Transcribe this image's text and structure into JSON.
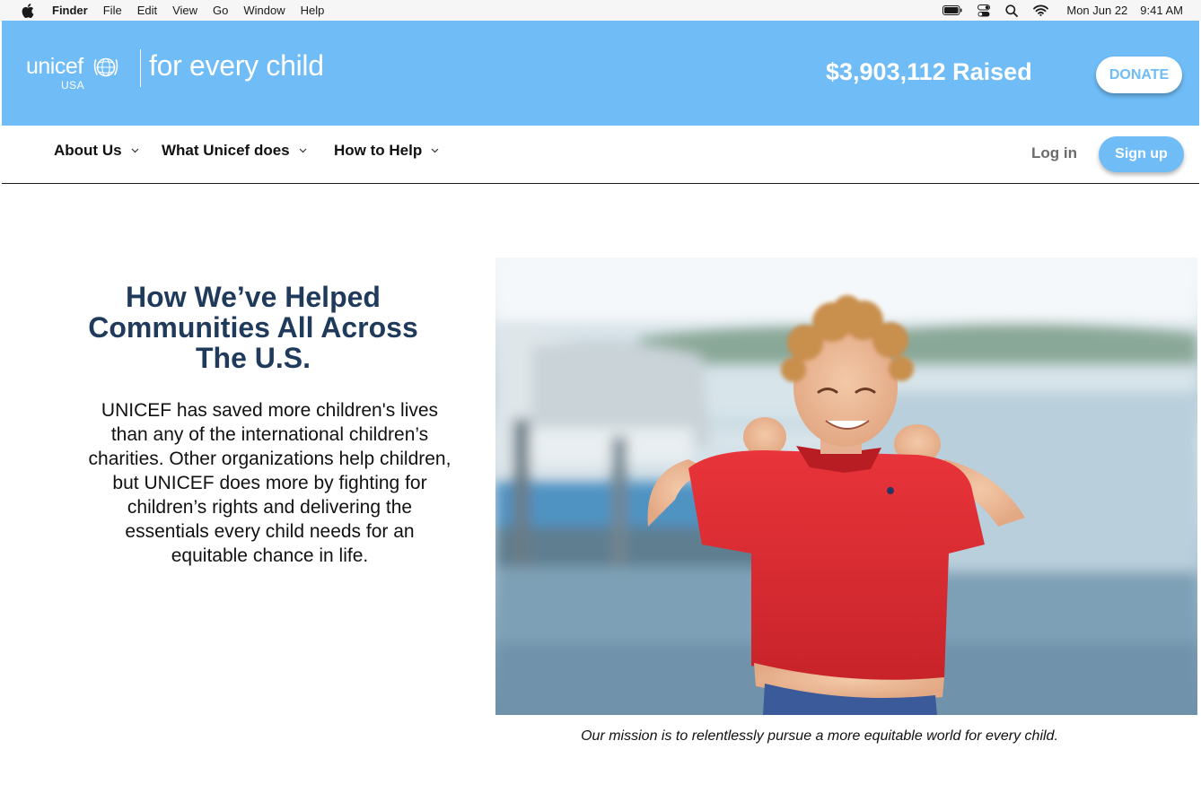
{
  "menubar": {
    "app_name": "Finder",
    "items": [
      "File",
      "Edit",
      "View",
      "Go",
      "Window",
      "Help"
    ],
    "date": "Mon Jun 22",
    "time": "9:41 AM",
    "icons": [
      "apple-icon",
      "battery-icon",
      "control-center-icon",
      "search-icon",
      "wifi-icon"
    ]
  },
  "header": {
    "logo_word": "unicef",
    "logo_sub": "USA",
    "tagline": "for every child",
    "raised": "$3,903,112 Raised",
    "donate_label": "DONATE"
  },
  "nav": {
    "items": [
      {
        "label": "About Us"
      },
      {
        "label": "What Unicef does"
      },
      {
        "label": "How to Help"
      }
    ],
    "login_label": "Log in",
    "signup_label": "Sign up"
  },
  "content": {
    "heading": "How We’ve Helped Communities All Across The U.S.",
    "body": "UNICEF has saved more children's lives than any of the international children’s charities. Other organizations help children, but UNICEF does more by fighting for children’s rights and delivering the essentials every child needs for an equitable chance in life.",
    "caption": "Our mission is to relentlessly pursue a more equitable world for every child."
  },
  "colors": {
    "brand_blue": "#6fbcf7",
    "heading_navy": "#1f3a5b",
    "login_gray": "#6b6b6b"
  }
}
